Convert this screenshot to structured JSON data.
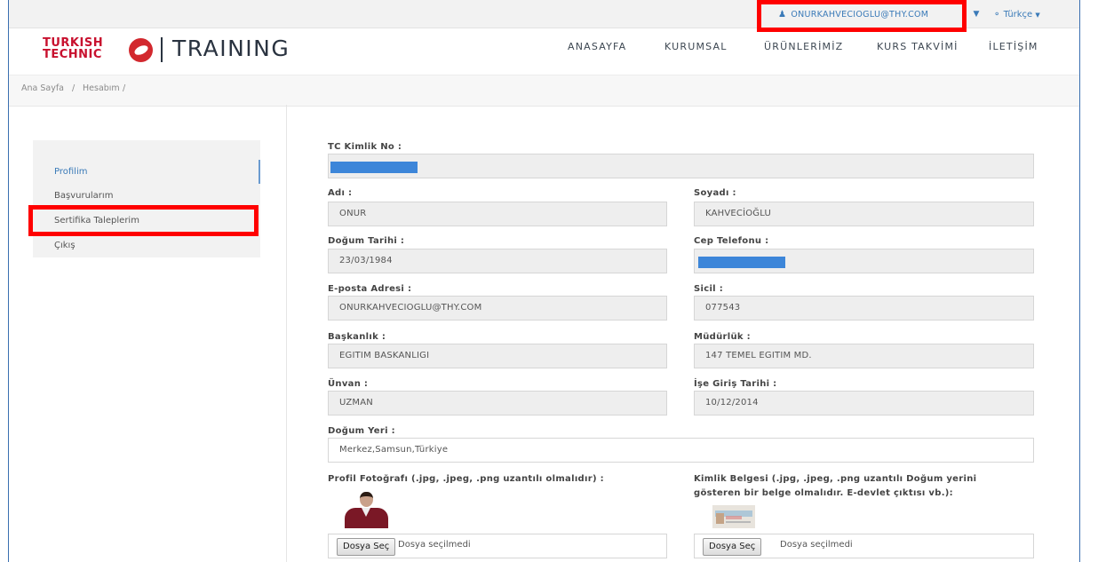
{
  "topbar": {
    "user_email": "ONURKAHVECIOGLU@THY.COM",
    "language": "Türkçe"
  },
  "brand": {
    "logo_line1": "TURKISH",
    "logo_line2": "TECHNIC",
    "product": "TRAINING"
  },
  "nav": [
    "ANASAYFA",
    "KURUMSAL",
    "ÜRÜNLERİMİZ",
    "KURS TAKVİMİ",
    "İLETİŞİM"
  ],
  "breadcrumb": {
    "home": "Ana Sayfa",
    "sep1": "/",
    "account": "Hesabım",
    "sep2": "/"
  },
  "sidebar": {
    "items": [
      "Profilim",
      "Başvurularım",
      "Sertifika Taleplerim",
      "Çıkış"
    ],
    "active": "Profilim"
  },
  "form": {
    "tc_label": "TC Kimlik No :",
    "name_label": "Adı :",
    "name_value": "ONUR",
    "surname_label": "Soyadı :",
    "surname_value": "KAHVECİOĞLU",
    "birthdate_label": "Doğum Tarihi :",
    "birthdate_value": "23/03/1984",
    "phone_label": "Cep Telefonu :",
    "email_label": "E-posta Adresi :",
    "email_value": "ONURKAHVECIOGLU@THY.COM",
    "sicil_label": "Sicil :",
    "sicil_value": "077543",
    "presidency_label": "Başkanlık :",
    "presidency_value": "EGITIM BASKANLIGI",
    "directorate_label": "Müdürlük :",
    "directorate_value": "147 TEMEL EGITIM MD.",
    "title_label": "Ünvan :",
    "title_value": "UZMAN",
    "start_date_label": "İşe Giriş Tarihi :",
    "start_date_value": "10/12/2014",
    "birthplace_label": "Doğum Yeri :",
    "birthplace_value": "Merkez,Samsun,Türkiye",
    "photo_label": "Profil Fotoğrafı (.jpg, .jpeg, .png uzantılı olmalıdır) :",
    "id_doc_label_1": "Kimlik Belgesi (.jpg, .jpeg, .png uzantılı Doğum yerini",
    "id_doc_label_2": "gösteren bir belge olmalıdır. E-devlet çıktısı vb.):",
    "file_button": "Dosya Seç",
    "file_none": "Dosya seçilmedi"
  },
  "colors": {
    "highlight": "#ff0000",
    "accent": "#3a7ab8",
    "redaction": "#3d86d9"
  }
}
